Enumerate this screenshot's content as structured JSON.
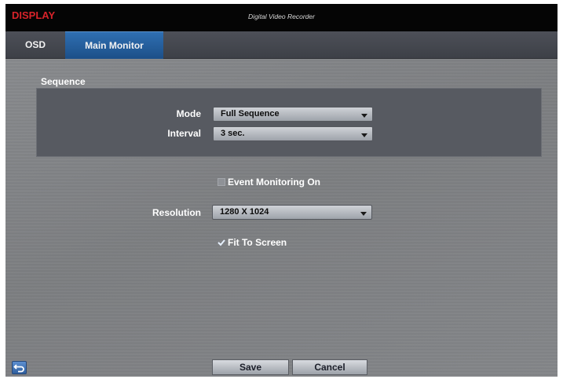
{
  "window": {
    "title": "DISPLAY",
    "product": "Digital Video Recorder"
  },
  "tabs": [
    {
      "label": "OSD",
      "active": false
    },
    {
      "label": "Main Monitor",
      "active": true
    }
  ],
  "sequence": {
    "section_title": "Sequence",
    "mode": {
      "label": "Mode",
      "value": "Full Sequence"
    },
    "interval": {
      "label": "Interval",
      "value": "3 sec."
    }
  },
  "event_monitoring": {
    "label": "Event Monitoring On",
    "checked": false
  },
  "resolution": {
    "label": "Resolution",
    "value": "1280 X 1024"
  },
  "fit_to_screen": {
    "label": "Fit To Screen",
    "checked": true
  },
  "footer": {
    "save_label": "Save",
    "cancel_label": "Cancel",
    "back_icon": "back-arrow-icon"
  },
  "colors": {
    "title_red": "#d8232a",
    "active_tab_blue": "#1c4f88",
    "panel_background": "#575a61"
  }
}
